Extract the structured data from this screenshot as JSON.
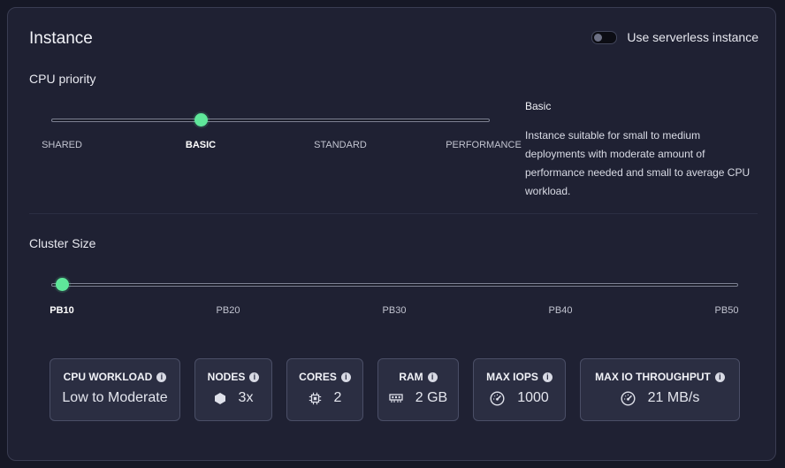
{
  "instance": {
    "title": "Instance",
    "serverless_label": "Use serverless instance"
  },
  "cpu_priority": {
    "label": "CPU priority",
    "options": [
      "SHARED",
      "BASIC",
      "STANDARD",
      "PERFORMANCE"
    ],
    "selected": "BASIC",
    "description_title": "Basic",
    "description": "Instance suitable for small to medium deployments with moderate amount of performance needed and small to average CPU workload."
  },
  "cluster_size": {
    "label": "Cluster Size",
    "options": [
      "PB10",
      "PB20",
      "PB30",
      "PB40",
      "PB50"
    ],
    "selected": "PB10"
  },
  "stats": {
    "cpu_workload": {
      "label": "CPU WORKLOAD",
      "value": "Low to Moderate"
    },
    "nodes": {
      "label": "NODES",
      "value": "3x",
      "icon": "hexagon-icon"
    },
    "cores": {
      "label": "CORES",
      "value": "2",
      "icon": "cpu-chip-icon"
    },
    "ram": {
      "label": "RAM",
      "value": "2 GB",
      "icon": "memory-icon"
    },
    "max_iops": {
      "label": "MAX IOPS",
      "value": "1000",
      "icon": "gauge-icon"
    },
    "max_io_throughput": {
      "label": "MAX IO THROUGHPUT",
      "value": "21 MB/s",
      "icon": "gauge-icon"
    }
  },
  "colors": {
    "accent": "#5fe79a",
    "panel": "#1f2133",
    "card": "#2b2e42"
  }
}
